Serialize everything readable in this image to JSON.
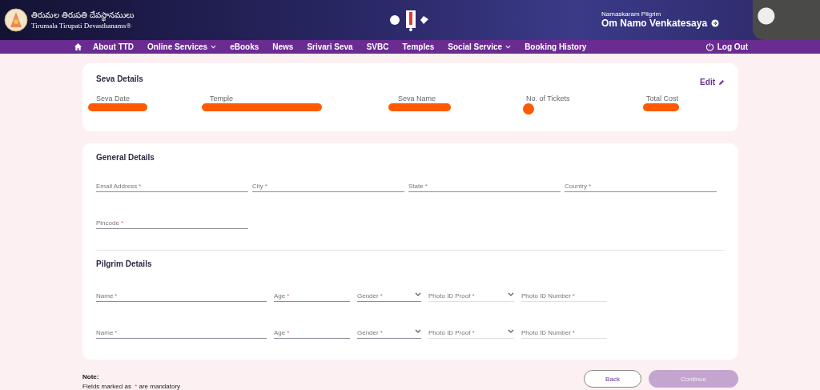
{
  "header": {
    "brand_telugu": "తిరుమల తిరుపతి దేవస్థానములు",
    "brand": "Tirumala Tirupati Devasthanams®",
    "greeting": "Namaskaram Pilgrim",
    "user": "Om Namo Venkatesaya"
  },
  "nav": {
    "items": [
      {
        "label": "About TTD",
        "dropdown": false
      },
      {
        "label": "Online Services",
        "dropdown": true
      },
      {
        "label": "eBooks",
        "dropdown": false
      },
      {
        "label": "News",
        "dropdown": false
      },
      {
        "label": "Srivari Seva",
        "dropdown": false
      },
      {
        "label": "SVBC",
        "dropdown": false
      },
      {
        "label": "Temples",
        "dropdown": false
      },
      {
        "label": "Social Service",
        "dropdown": true
      },
      {
        "label": "Booking History",
        "dropdown": false
      }
    ],
    "logout": "Log Out"
  },
  "seva_details": {
    "title": "Seva Details",
    "edit": "Edit",
    "fields": [
      {
        "label": "Seva Date",
        "redacted": true
      },
      {
        "label": "Temple",
        "redacted": true
      },
      {
        "label": "Seva Name",
        "redacted": true
      },
      {
        "label": "No. of Tickets",
        "redacted": true
      },
      {
        "label": "Total Cost",
        "redacted": true
      }
    ]
  },
  "general_details": {
    "title": "General Details",
    "fields": [
      {
        "label": "Email Address",
        "required": true
      },
      {
        "label": "City",
        "required": true
      },
      {
        "label": "State",
        "required": true
      },
      {
        "label": "Country",
        "required": true
      },
      {
        "label": "Pincode",
        "required": true
      }
    ]
  },
  "pilgrim_details": {
    "title": "Pilgrim Details",
    "rows": [
      [
        {
          "label": "Name",
          "kind": "text",
          "required": true,
          "disabled": false
        },
        {
          "label": "Age",
          "kind": "text",
          "required": true,
          "disabled": false
        },
        {
          "label": "Gender",
          "kind": "select",
          "required": true,
          "disabled": false
        },
        {
          "label": "Photo ID Proof",
          "kind": "select",
          "required": true,
          "disabled": true
        },
        {
          "label": "Photo ID Number",
          "kind": "text",
          "required": true,
          "disabled": true
        }
      ],
      [
        {
          "label": "Name",
          "kind": "text",
          "required": true,
          "disabled": false
        },
        {
          "label": "Age",
          "kind": "text",
          "required": true,
          "disabled": false
        },
        {
          "label": "Gender",
          "kind": "select",
          "required": true,
          "disabled": false
        },
        {
          "label": "Photo ID Proof",
          "kind": "select",
          "required": true,
          "disabled": true
        },
        {
          "label": "Photo ID Number",
          "kind": "text",
          "required": true,
          "disabled": true
        }
      ]
    ]
  },
  "note": {
    "title": "Note:",
    "text_before": "Fields marked as",
    "mark": "*",
    "text_after": "are mandatory"
  },
  "buttons": [
    {
      "label": "Back",
      "kind": "outline",
      "disabled": false
    },
    {
      "label": "Continue",
      "kind": "primary",
      "disabled": true
    }
  ]
}
